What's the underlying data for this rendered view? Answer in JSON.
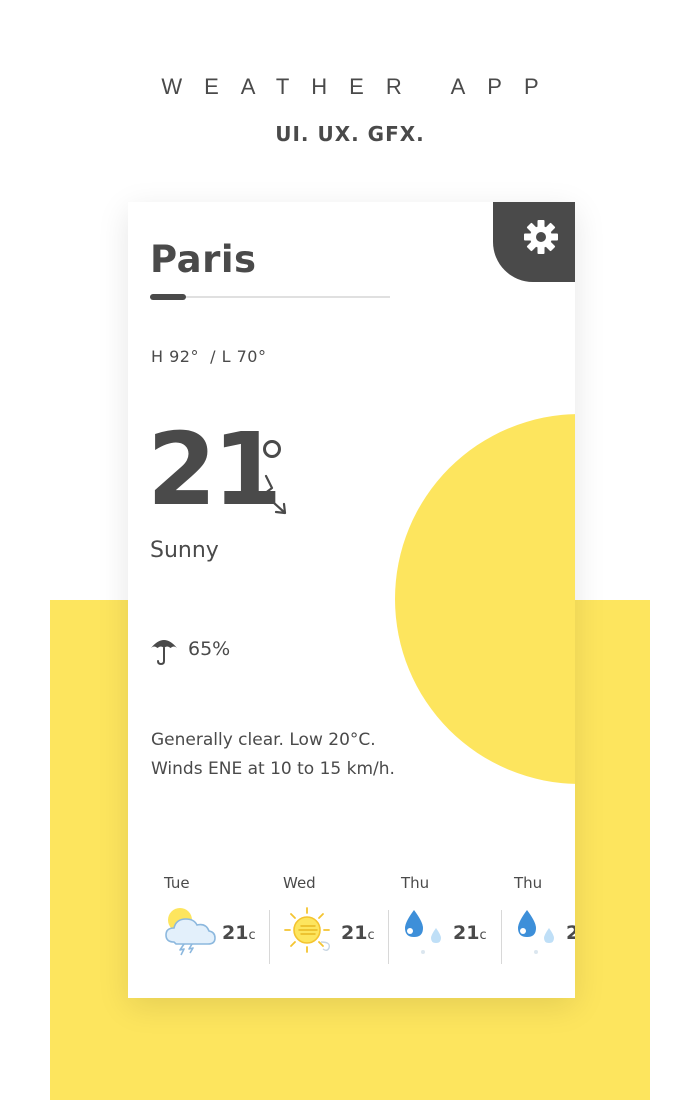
{
  "hero": {
    "title": "WEATHER APP",
    "subtitle": "UI. UX. GFX."
  },
  "colors": {
    "accent_yellow": "#fde55e",
    "dark_gray": "#4a4a4a",
    "rain_blue": "#3d8fd9",
    "light_blue": "#bfdff7"
  },
  "card": {
    "city": "Paris",
    "high_low": "H 92°  / L 70°",
    "temperature": "21",
    "condition": "Sunny",
    "precipitation": "65%",
    "summary_line1": "Generally clear. Low 20°C.",
    "summary_line2": "Winds ENE at 10 to 15 km/h.",
    "settings_icon": "gear-icon",
    "trend_icon": "trend-down-icon",
    "precip_icon": "umbrella-icon"
  },
  "forecast": [
    {
      "day": "Tue",
      "temp": "21",
      "unit": "c",
      "icon": "cloud-thunder-sun-icon"
    },
    {
      "day": "Wed",
      "temp": "21",
      "unit": "c",
      "icon": "sun-windy-icon"
    },
    {
      "day": "Thu",
      "temp": "21",
      "unit": "c",
      "icon": "rain-drops-icon"
    },
    {
      "day": "Thu",
      "temp": "2",
      "unit": "",
      "icon": "rain-drops-icon"
    }
  ]
}
